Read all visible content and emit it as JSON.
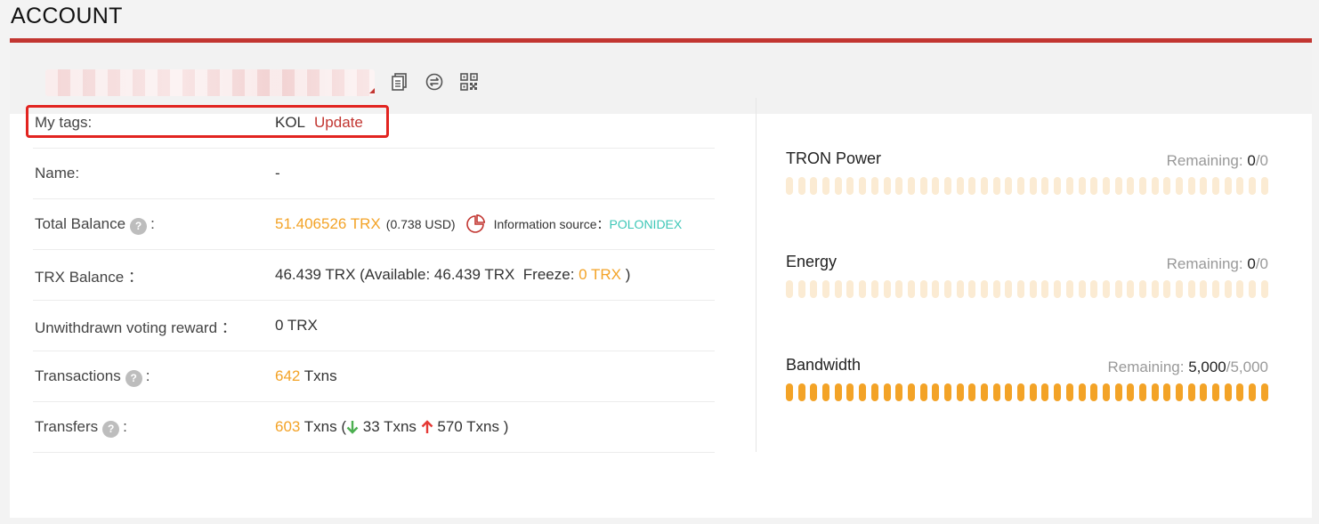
{
  "page_title": "ACCOUNT",
  "colors": {
    "accent_red": "#c23631",
    "orange": "#f3a327",
    "teal": "#3dc7b7",
    "bar_empty": "#fbebd3",
    "bar_full": "#f3a327",
    "highlight": "#e22420"
  },
  "address_bar": {
    "icons": [
      "copy-icon",
      "transfer-icon",
      "qrcode-icon"
    ]
  },
  "rows": {
    "tags": {
      "label": "My tags:",
      "value": "KOL",
      "action": "Update"
    },
    "name": {
      "label": "Name:",
      "value": "-"
    },
    "total_balance": {
      "label": "Total Balance",
      "colon": ":",
      "trx": "51.406526 TRX",
      "usd": "(0.738 USD)",
      "source_label": "Information source：",
      "source": "POLONIDEX"
    },
    "trx_balance": {
      "label": "TRX Balance ：",
      "main": "46.439 TRX (Available: 46.439 TRX  Freeze: ",
      "freeze": "0 TRX",
      "close": " )"
    },
    "reward": {
      "label": "Unwithdrawn voting reward ：",
      "value": "0 TRX"
    },
    "transactions": {
      "label": "Transactions",
      "colon": ":",
      "count": "642",
      "unit": " Txns"
    },
    "transfers": {
      "label": "Transfers",
      "colon": ":",
      "count": "603",
      "unit": " Txns (",
      "in": " 33 Txns ",
      "out": " 570 Txns )"
    }
  },
  "resources": [
    {
      "name": "TRON Power",
      "remaining_label": "Remaining: ",
      "current": "0",
      "total": "/0",
      "fill": 0
    },
    {
      "name": "Energy",
      "remaining_label": "Remaining: ",
      "current": "0",
      "total": "/0",
      "fill": 0
    },
    {
      "name": "Bandwidth",
      "remaining_label": "Remaining: ",
      "current": "5,000",
      "total": "/5,000",
      "fill": 1
    }
  ]
}
